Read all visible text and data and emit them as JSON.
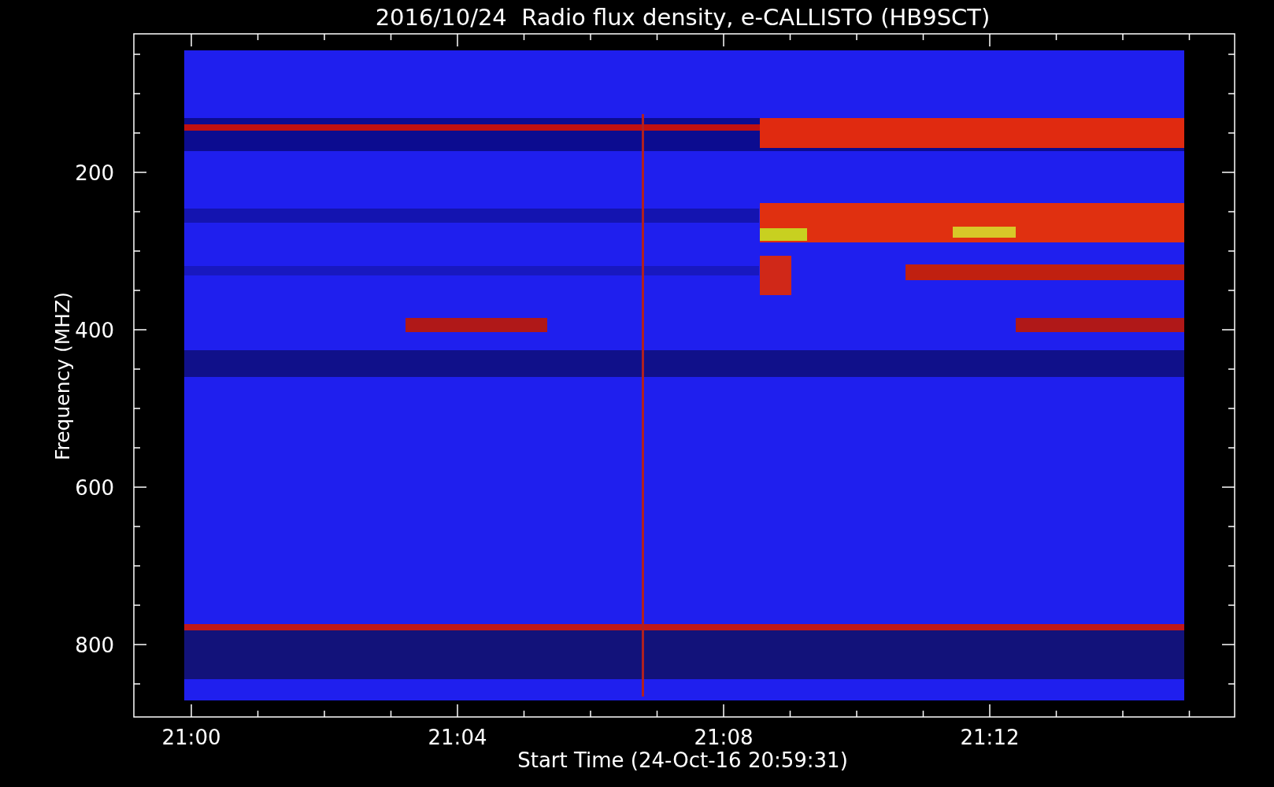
{
  "title": "2016/10/24  Radio flux density, e-CALLISTO (HB9SCT)",
  "y_axis": {
    "label": "Frequency (MHZ)",
    "ticks": [
      "200",
      "400",
      "600",
      "800"
    ]
  },
  "x_axis": {
    "label": "Start Time (24-Oct-16 20:59:31)",
    "ticks": [
      "21:00",
      "21:04",
      "21:08",
      "21:12"
    ]
  }
}
